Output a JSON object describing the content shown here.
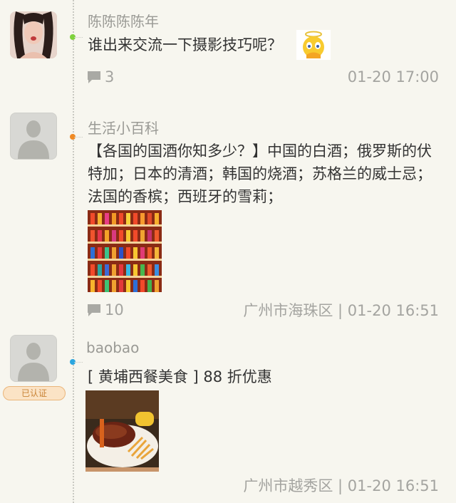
{
  "posts": [
    {
      "username": "陈陈陈陈年",
      "content": "谁出来交流一下摄影技巧呢？",
      "comment_count": "3",
      "time": "01-20 17:00",
      "avatar_icon": "user-photo",
      "emoji_icon": "angel-emoji",
      "dot_color": "#7ed23d"
    },
    {
      "username": "生活小百科",
      "content": "【各国的国酒你知多少？】中国的白酒；俄罗斯的伏特加；日本的清酒；韩国的烧酒；苏格兰的威士忌；法国的香槟；西班牙的雪莉；",
      "comment_count": "10",
      "location": "广州市海珠区",
      "time": "01-20 16:51",
      "avatar_icon": "default-user-icon",
      "dot_color": "#f08a24"
    },
    {
      "username": "baobao",
      "content": "[ 黄埔西餐美食 ] 88 折优惠",
      "badge": "已认证",
      "location": "广州市越秀区",
      "time": "01-20 16:51",
      "avatar_icon": "default-user-icon",
      "dot_color": "#2ba6e0"
    }
  ],
  "separator": " | "
}
